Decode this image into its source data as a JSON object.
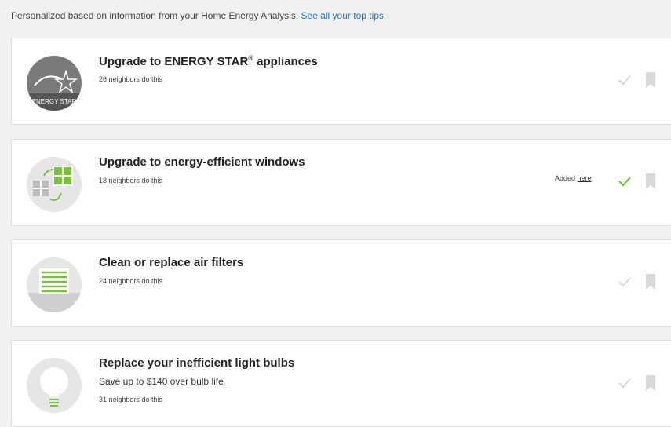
{
  "intro": {
    "text": "Personalized based on information from your Home Energy Analysis.",
    "link": "See all your top tips."
  },
  "tips": [
    {
      "title": "Upgrade to ENERGY STAR",
      "title_sup": "®",
      "title_suffix": " appliances",
      "neighbors": "26 neighbors do this",
      "icon": "energy-star-icon",
      "icon_text": "ENERGY STAR",
      "done": false
    },
    {
      "title": "Upgrade to energy-efficient windows",
      "neighbors": "18 neighbors do this",
      "icon": "windows-icon",
      "added_text": "Added",
      "added_link": "here",
      "done": true
    },
    {
      "title": "Clean or replace air filters",
      "neighbors": "24 neighbors do this",
      "icon": "air-filter-icon",
      "done": false
    },
    {
      "title": "Replace your inefficient light bulbs",
      "subtitle": "Save up to $140 over bulb life",
      "neighbors": "31 neighbors do this",
      "icon": "light-bulb-icon",
      "done": false
    }
  ],
  "colors": {
    "accent_green": "#7bc142",
    "link_blue": "#1a73c9",
    "inactive_gray": "#d9d9d9"
  }
}
